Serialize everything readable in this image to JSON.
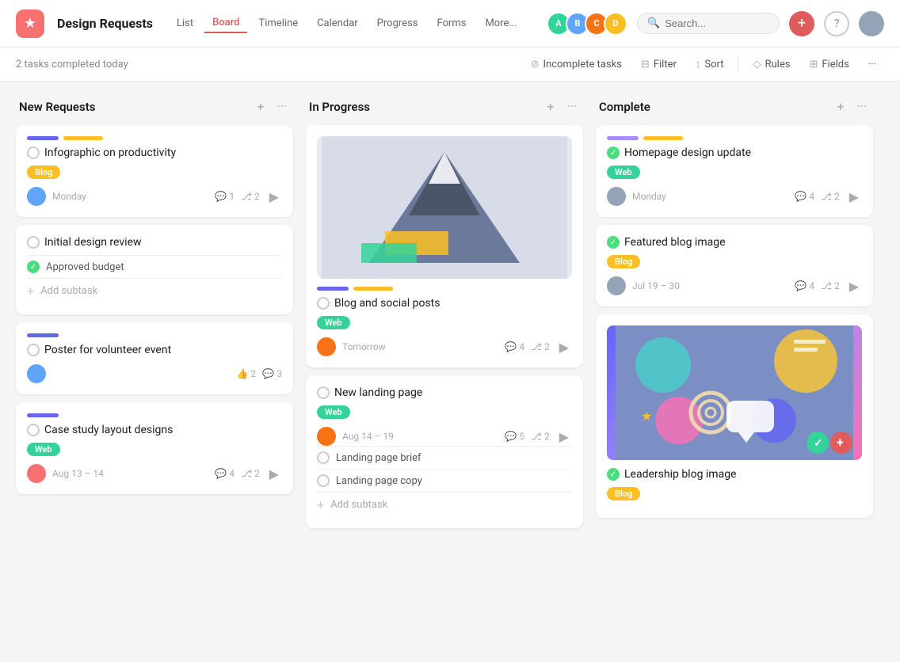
{
  "app": {
    "title": "Design Requests",
    "logo": "★"
  },
  "nav": {
    "tabs": [
      {
        "label": "List",
        "active": false
      },
      {
        "label": "Board",
        "active": true
      },
      {
        "label": "Timeline",
        "active": false
      },
      {
        "label": "Calendar",
        "active": false
      },
      {
        "label": "Progress",
        "active": false
      },
      {
        "label": "Forms",
        "active": false
      },
      {
        "label": "More...",
        "active": false
      }
    ]
  },
  "toolbar": {
    "completed_text": "2 tasks completed today",
    "filter_label": "Incomplete tasks",
    "filter2_label": "Filter",
    "sort_label": "Sort",
    "rules_label": "Rules",
    "fields_label": "Fields"
  },
  "columns": [
    {
      "id": "new-requests",
      "title": "New Requests",
      "cards": [
        {
          "id": "card1",
          "tag_colors": [
            "#6366f1",
            "#fbbf24"
          ],
          "title": "Infographic on productivity",
          "completed": false,
          "badge": "Blog",
          "badge_type": "blog",
          "date": "Monday",
          "avatar_color": "av2",
          "comments": "1",
          "subtasks": "2",
          "has_expand": true,
          "has_subtasks": false
        },
        {
          "id": "card2",
          "tag_colors": [],
          "title": "Initial design review",
          "completed": false,
          "badge": null,
          "subtask_items": [
            {
              "label": "Approved budget",
              "done": true
            }
          ],
          "add_subtask": true
        },
        {
          "id": "card3",
          "tag_colors": [
            "#6366f1"
          ],
          "title": "Poster for volunteer event",
          "completed": false,
          "badge": null,
          "avatar_color": "av2",
          "likes": "2",
          "comments": "3"
        },
        {
          "id": "card4",
          "tag_colors": [
            "#6366f1"
          ],
          "title": "Case study layout designs",
          "completed": false,
          "badge": "Web",
          "badge_type": "web",
          "date": "Aug 13 – 14",
          "avatar_color": "av5",
          "comments": "4",
          "subtasks": "2",
          "has_expand": true
        }
      ]
    },
    {
      "id": "in-progress",
      "title": "In Progress",
      "cards": [
        {
          "id": "card5",
          "has_image": true,
          "tag_colors": [
            "#6366f1",
            "#fbbf24"
          ],
          "title": "Blog and social posts",
          "completed": false,
          "badge": "Web",
          "badge_type": "web",
          "date": "Tomorrow",
          "avatar_color": "av3",
          "comments": "4",
          "subtasks": "2",
          "has_expand": true
        },
        {
          "id": "card6",
          "title": "New landing page",
          "completed": false,
          "badge": "Web",
          "badge_type": "web",
          "date": "Aug 14 – 19",
          "avatar_color": "av3",
          "comments": "5",
          "subtasks": "2",
          "has_expand": true,
          "subtask_items": [
            {
              "label": "Landing page brief",
              "done": false
            },
            {
              "label": "Landing page copy",
              "done": false
            }
          ],
          "add_subtask": true
        }
      ]
    },
    {
      "id": "complete",
      "title": "Complete",
      "cards": [
        {
          "id": "card7",
          "tag_colors": [
            "#a78bfa",
            "#fbbf24"
          ],
          "title": "Homepage design update",
          "completed": true,
          "badge": "Web",
          "badge_type": "web",
          "date": "Monday",
          "avatar_color": "av6",
          "comments": "4",
          "subtasks": "2",
          "has_expand": true
        },
        {
          "id": "card8",
          "tag_colors": [],
          "title": "Featured blog image",
          "completed": true,
          "badge": "Blog",
          "badge_type": "blog",
          "date": "Jul 19 – 30",
          "avatar_color": "av6",
          "comments": "4",
          "subtasks": "2",
          "has_expand": true
        },
        {
          "id": "card9",
          "has_complete_image": true,
          "title": "Leadership blog image",
          "completed": true,
          "badge": "Blog",
          "badge_type": "blog"
        }
      ]
    }
  ]
}
